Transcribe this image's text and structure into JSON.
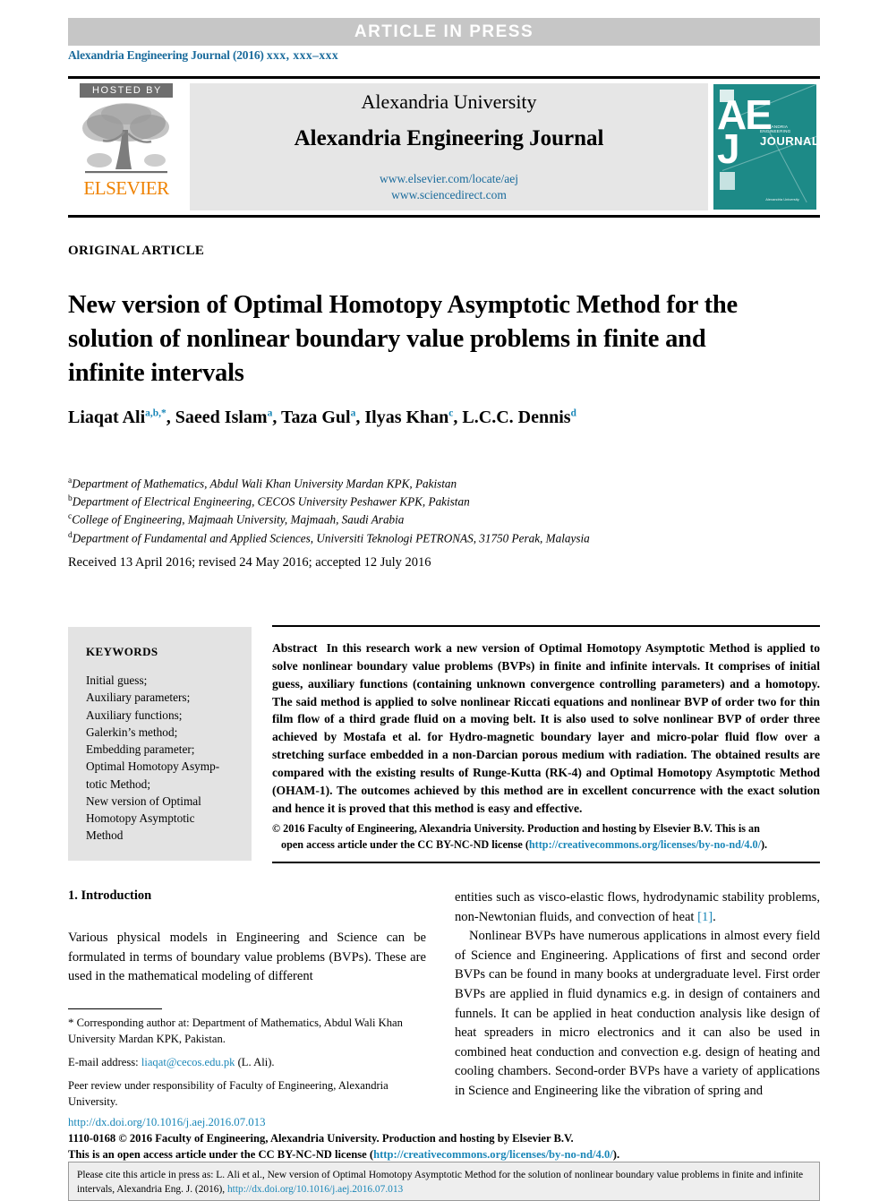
{
  "banner": {
    "text": "ARTICLE  IN  PRESS"
  },
  "journal_ref": {
    "prefix": "Alexandria Engineering Journal (2016) ",
    "volume": "xxx, xxx–xxx"
  },
  "masthead": {
    "hosted_by": "HOSTED BY",
    "publisher": "ELSEVIER",
    "university": "Alexandria University",
    "journal_title": "Alexandria Engineering Journal",
    "link_elsevier": "www.elsevier.com/locate/aej",
    "link_sciencedirect": "www.sciencedirect.com",
    "cover": {
      "monogram_line1": "AE",
      "monogram_line2": "J",
      "journal_word": "OURNAL",
      "journal_word_initial": "J",
      "journal_small": "ALEXANDRIA ENGINEERING",
      "footer_small": "Alexandria University"
    }
  },
  "article": {
    "type": "ORIGINAL ARTICLE",
    "title": "New version of Optimal Homotopy Asymptotic Method for the solution of nonlinear boundary value problems in finite and infinite intervals",
    "authors_html": "Liaqat Ali<sup>a,b,*</sup>, Saeed Islam<sup>a</sup>, Taza Gul<sup>a</sup>, Ilyas Khan<sup>c</sup>, L.C.C. Dennis<sup>d</sup>",
    "affiliations": [
      {
        "mark": "a",
        "text": "Department of Mathematics, Abdul Wali Khan University Mardan KPK, Pakistan"
      },
      {
        "mark": "b",
        "text": "Department of Electrical Engineering, CECOS University Peshawer KPK, Pakistan"
      },
      {
        "mark": "c",
        "text": "College of Engineering, Majmaah University, Majmaah, Saudi Arabia"
      },
      {
        "mark": "d",
        "text": "Department of Fundamental and Applied Sciences, Universiti Teknologi PETRONAS, 31750 Perak, Malaysia"
      }
    ],
    "dates": "Received 13 April 2016; revised 24 May 2016; accepted 12 July 2016"
  },
  "keywords": {
    "heading": "KEYWORDS",
    "items": "Initial guess;\nAuxiliary parameters;\nAuxiliary functions;\nGalerkin’s method;\nEmbedding parameter;\nOptimal Homotopy Asymp-\ntotic Method;\nNew version of Optimal\nHomotopy Asymptotic\nMethod"
  },
  "abstract": {
    "label": "Abstract",
    "text": "In this research work a new version of Optimal Homotopy Asymptotic Method is applied to solve nonlinear boundary value problems (BVPs) in finite and infinite intervals. It comprises of initial guess, auxiliary functions (containing unknown convergence controlling parameters) and a homotopy. The said method is applied to solve nonlinear Riccati equations and nonlinear BVP of order two for thin film flow of a third grade fluid on a moving belt. It is also used to solve nonlinear BVP of order three achieved by Mostafa et al. for Hydro-magnetic boundary layer and micro-polar fluid flow over a stretching surface embedded in a non-Darcian porous medium with radiation. The obtained results are compared with the existing results of Runge-Kutta (RK-4) and Optimal Homotopy Asymptotic Method (OHAM-1). The outcomes achieved by this method are in excellent concurrence with the exact solution and hence it is proved that this method is easy and effective.",
    "copyright_line1": "© 2016 Faculty of Engineering, Alexandria University. Production and hosting by Elsevier B.V. This is an",
    "copyright_line2_pre": "open access article under the CC BY-NC-ND license (",
    "copyright_link": "http://creativecommons.org/licenses/by-no-nd/4.0/",
    "copyright_line2_post": ")."
  },
  "body": {
    "section_heading": "1. Introduction",
    "left_paragraph": "Various physical models in Engineering and Science can be formulated in terms of boundary value problems (BVPs). These are used in the mathematical modeling of different",
    "right_paragraph_1_pre": "entities such as visco-elastic flows, hydrodynamic stability problems, non-Newtonian fluids, and convection of heat ",
    "right_paragraph_1_ref": "[1]",
    "right_paragraph_1_post": ".",
    "right_paragraph_2": "Nonlinear BVPs have numerous applications in almost every field of Science and Engineering. Applications of first and second order BVPs can be found in many books at undergraduate level. First order BVPs are applied in fluid dynamics e.g. in design of containers and funnels. It can be applied in heat conduction analysis like design of heat spreaders in micro electronics and it can also be used in combined heat conduction and convection e.g. design of heating and cooling chambers. Second-order BVPs have a variety of applications in Science and Engineering like the vibration of spring and"
  },
  "footnotes": {
    "corresponding": "Corresponding author at: Department of Mathematics, Abdul Wali Khan University Mardan KPK, Pakistan.",
    "email_label": "E-mail address: ",
    "email": "liaqat@cecos.edu.pk",
    "email_suffix": " (L. Ali).",
    "peer_review": "Peer review under responsibility of Faculty of Engineering, Alexandria University."
  },
  "footer": {
    "doi": "http://dx.doi.org/10.1016/j.aej.2016.07.013",
    "issn_line": "1110-0168 © 2016 Faculty of Engineering, Alexandria University. Production and hosting by Elsevier B.V.",
    "license_pre": "This is an open access article under the CC BY-NC-ND license (",
    "license_link": "http://creativecommons.org/licenses/by-no-nd/4.0/",
    "license_post": ")."
  },
  "cite_box": {
    "text_pre": "Please cite this article in press as: L. Ali et al., New version of Optimal Homotopy Asymptotic Method for the solution of nonlinear boundary value problems in finite and infinite intervals,  Alexandria Eng. J. (2016), ",
    "link": "http://dx.doi.org/10.1016/j.aej.2016.07.013"
  },
  "colors": {
    "link": "#1a87b8",
    "journal_ref": "#1a6b9c",
    "elsevier_orange": "#ef8200",
    "banner_bg": "#c6c6c6",
    "cover_teal": "#1d8a87",
    "keyword_bg": "#e3e3e3"
  }
}
